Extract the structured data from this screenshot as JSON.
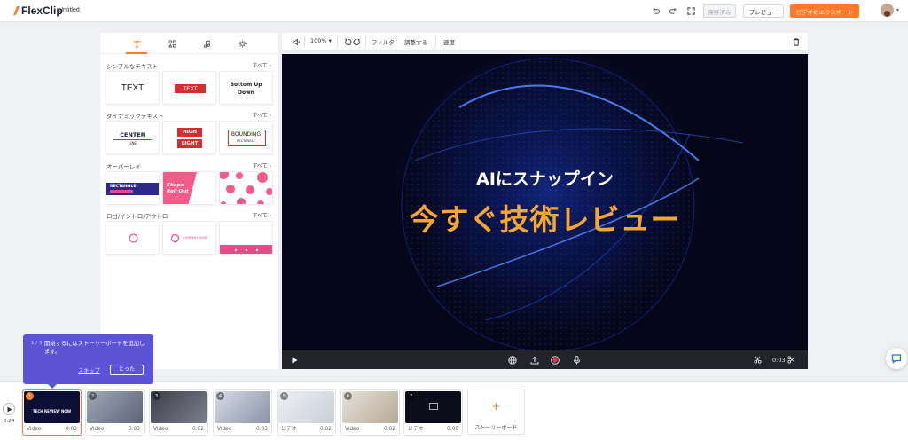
{
  "app": {
    "name": "FlexClip",
    "doc_title": "Untitled"
  },
  "header": {
    "undo_icon": "undo-icon",
    "redo_icon": "redo-icon",
    "fullscreen_icon": "fullscreen-icon",
    "save_label": "保存済み",
    "preview_label": "プレビュー",
    "export_label": "ビデオのエクスポート",
    "accent": "#ff7a2a"
  },
  "panel": {
    "tabs": [
      "text-tab",
      "elements-tab",
      "music-tab",
      "settings-tab"
    ],
    "sections": [
      {
        "title": "シンプルなテキスト",
        "all": "すべて"
      },
      {
        "title": "ダイナミックテキスト",
        "all": "すべて"
      },
      {
        "title": "オーバーレイ",
        "all": "すべて"
      },
      {
        "title": "ロゴ/イントロ/アウトロ",
        "all": "すべて"
      }
    ],
    "simple": {
      "text1": "TEXT",
      "text2": "TEXT",
      "text3a": "Bottom Up",
      "text3b": "Down"
    },
    "dynamic": {
      "center": "CENTER",
      "center_sub": "LINE",
      "high": "HIGH",
      "light": "LIGHT",
      "bounding": "BOUNDING",
      "bounding_sub": "RECTANGLE"
    },
    "overlay": {
      "rect": "RECTANGLE",
      "shape1": "Shape",
      "shape2": "Roll Out"
    },
    "logo": {
      "company": "COMPANY NAME"
    }
  },
  "toolbar": {
    "zoom": "100%",
    "filter": "フィルタ",
    "adjust": "調整する",
    "speed": "速度"
  },
  "canvas": {
    "line1": "AIにスナップイン",
    "line2": "今すぐ技術レビュー",
    "line2_color": "#f5a531"
  },
  "player": {
    "time": "0:03"
  },
  "tooltip": {
    "step": "1 / 3",
    "message": "開始するにはストーリーボードを追加します。",
    "skip": "スキップ",
    "ok": "とった"
  },
  "timeline": {
    "total": "0:24",
    "clips": [
      {
        "num": "1",
        "label": "Video",
        "dur": "0:03",
        "title": "TECH REVIEW NOW"
      },
      {
        "num": "2",
        "label": "Video",
        "dur": "0:03"
      },
      {
        "num": "3",
        "label": "Video",
        "dur": "0:02"
      },
      {
        "num": "4",
        "label": "Video",
        "dur": "0:03"
      },
      {
        "num": "5",
        "label": "ビデオ",
        "dur": "0:02"
      },
      {
        "num": "6",
        "label": "Video",
        "dur": "0:02"
      },
      {
        "num": "7",
        "label": "ビデオ",
        "dur": "0:06"
      }
    ],
    "add_label": "ストーリーボード"
  }
}
